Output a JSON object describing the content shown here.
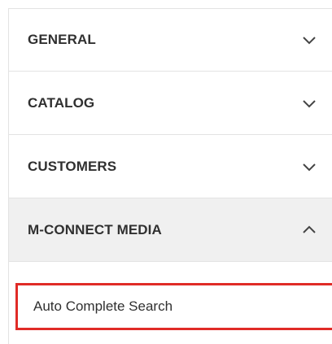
{
  "sections": [
    {
      "title": "GENERAL",
      "icon": "chevron-down-icon",
      "expanded": false
    },
    {
      "title": "CATALOG",
      "icon": "chevron-down-icon",
      "expanded": false
    },
    {
      "title": "CUSTOMERS",
      "icon": "chevron-down-icon",
      "expanded": false
    },
    {
      "title": "M-CONNECT MEDIA",
      "icon": "chevron-up-icon",
      "expanded": true
    }
  ],
  "submenu": {
    "items": [
      {
        "label": "Auto Complete Search",
        "highlighted": true
      }
    ]
  },
  "colors": {
    "highlight_border": "#e02b27",
    "open_section_bg": "#f0f0f0",
    "text": "#303030",
    "divider": "#e3e3e3"
  }
}
